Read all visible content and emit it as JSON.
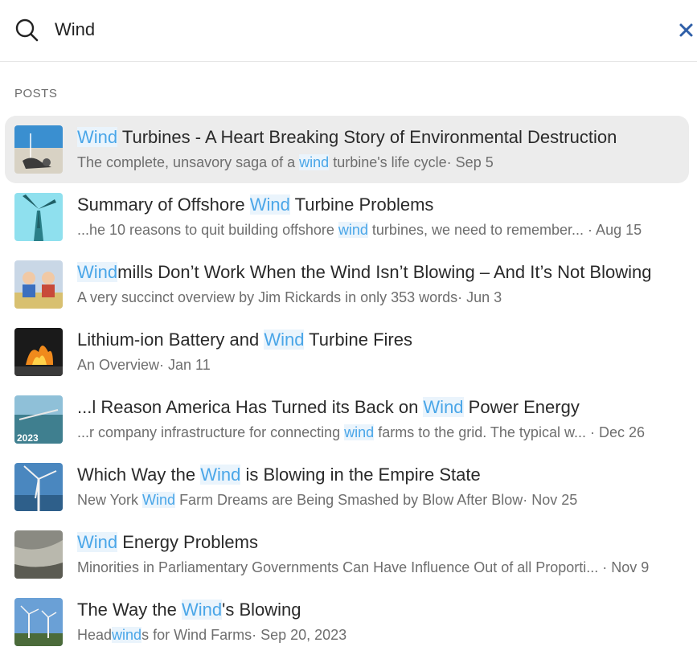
{
  "search": {
    "query": "Wind",
    "close_glyph": "✕"
  },
  "section_label": "POSTS",
  "results": [
    {
      "title": [
        {
          "t": "Wind",
          "h": true
        },
        {
          "t": " Turbines - A Heart Breaking Story of Environmental Destruction",
          "h": false
        }
      ],
      "meta": [
        {
          "t": "The complete, unsavory saga of a ",
          "h": false
        },
        {
          "t": "wind",
          "h": true
        },
        {
          "t": " turbine's life cycle· Sep 5",
          "h": false
        }
      ],
      "active": true
    },
    {
      "title": [
        {
          "t": "Summary of Offshore ",
          "h": false
        },
        {
          "t": "Wind",
          "h": true
        },
        {
          "t": " Turbine Problems",
          "h": false
        }
      ],
      "meta": [
        {
          "t": "...he 10 reasons to quit building offshore ",
          "h": false
        },
        {
          "t": "wind",
          "h": true
        },
        {
          "t": " turbines, we need to remember... · Aug 15",
          "h": false
        }
      ],
      "active": false
    },
    {
      "title": [
        {
          "t": "Wind",
          "h": true
        },
        {
          "t": "mills Don’t Work When the Wind Isn’t Blowing – And It’s Not Blowing",
          "h": false
        }
      ],
      "meta": [
        {
          "t": "A very succinct overview by Jim Rickards in only 353 words· Jun 3",
          "h": false
        }
      ],
      "active": false
    },
    {
      "title": [
        {
          "t": "Lithium-ion Battery and ",
          "h": false
        },
        {
          "t": "Wind",
          "h": true
        },
        {
          "t": " Turbine Fires",
          "h": false
        }
      ],
      "meta": [
        {
          "t": "An Overview· Jan 11",
          "h": false
        }
      ],
      "active": false
    },
    {
      "title": [
        {
          "t": "...l Reason America Has Turned its Back on ",
          "h": false
        },
        {
          "t": "Wind",
          "h": true
        },
        {
          "t": " Power Energy",
          "h": false
        }
      ],
      "meta": [
        {
          "t": "...r company infrastructure for connecting ",
          "h": false
        },
        {
          "t": "wind",
          "h": true
        },
        {
          "t": " farms to the grid. The typical w... · Dec 26",
          "h": false
        }
      ],
      "active": false
    },
    {
      "title": [
        {
          "t": "Which Way the ",
          "h": false
        },
        {
          "t": "Wind",
          "h": true
        },
        {
          "t": " is Blowing in the Empire State",
          "h": false
        }
      ],
      "meta": [
        {
          "t": "New York ",
          "h": false
        },
        {
          "t": "Wind",
          "h": true
        },
        {
          "t": " Farm Dreams are Being Smashed by Blow After Blow· Nov 25",
          "h": false
        }
      ],
      "active": false
    },
    {
      "title": [
        {
          "t": "Wind",
          "h": true
        },
        {
          "t": " Energy Problems",
          "h": false
        }
      ],
      "meta": [
        {
          "t": "Minorities in Parliamentary Governments Can Have Influence Out of all Proporti... · Nov 9",
          "h": false
        }
      ],
      "active": false
    },
    {
      "title": [
        {
          "t": "The Way the ",
          "h": false
        },
        {
          "t": "Wind",
          "h": true
        },
        {
          "t": "'s Blowing",
          "h": false
        }
      ],
      "meta": [
        {
          "t": "Head",
          "h": false
        },
        {
          "t": "wind",
          "h": true
        },
        {
          "t": "s for Wind Farms· Sep 20, 2023",
          "h": false
        }
      ],
      "active": false
    }
  ],
  "thumb5_text": "2023",
  "colors": {
    "highlight_text": "#4aa6e8",
    "highlight_bg": "#eaf4fc",
    "active_row": "#ececec",
    "close": "#2f5fa8"
  }
}
